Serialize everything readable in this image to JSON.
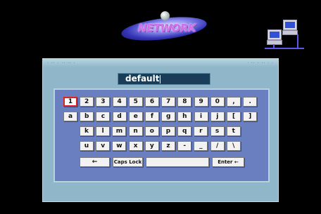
{
  "logo": {
    "text": "NETWORK"
  },
  "input": {
    "value": "default"
  },
  "keyboard": {
    "selected_key": "1",
    "rows": [
      [
        "1",
        "2",
        "3",
        "4",
        "5",
        "6",
        "7",
        "8",
        "9",
        "0",
        ",",
        "."
      ],
      [
        "a",
        "b",
        "c",
        "d",
        "e",
        "f",
        "g",
        "h",
        "i",
        "j",
        "[",
        "]"
      ],
      [
        "k",
        "l",
        "m",
        "n",
        "o",
        "p",
        "q",
        "r",
        "s",
        "t"
      ],
      [
        "u",
        "v",
        "w",
        "x",
        "y",
        "z",
        "-",
        "_",
        "/",
        "\\"
      ]
    ],
    "bottom": {
      "backspace": "←",
      "caps_lock": "Caps Lock",
      "space": "",
      "enter": "Enter ←"
    }
  }
}
